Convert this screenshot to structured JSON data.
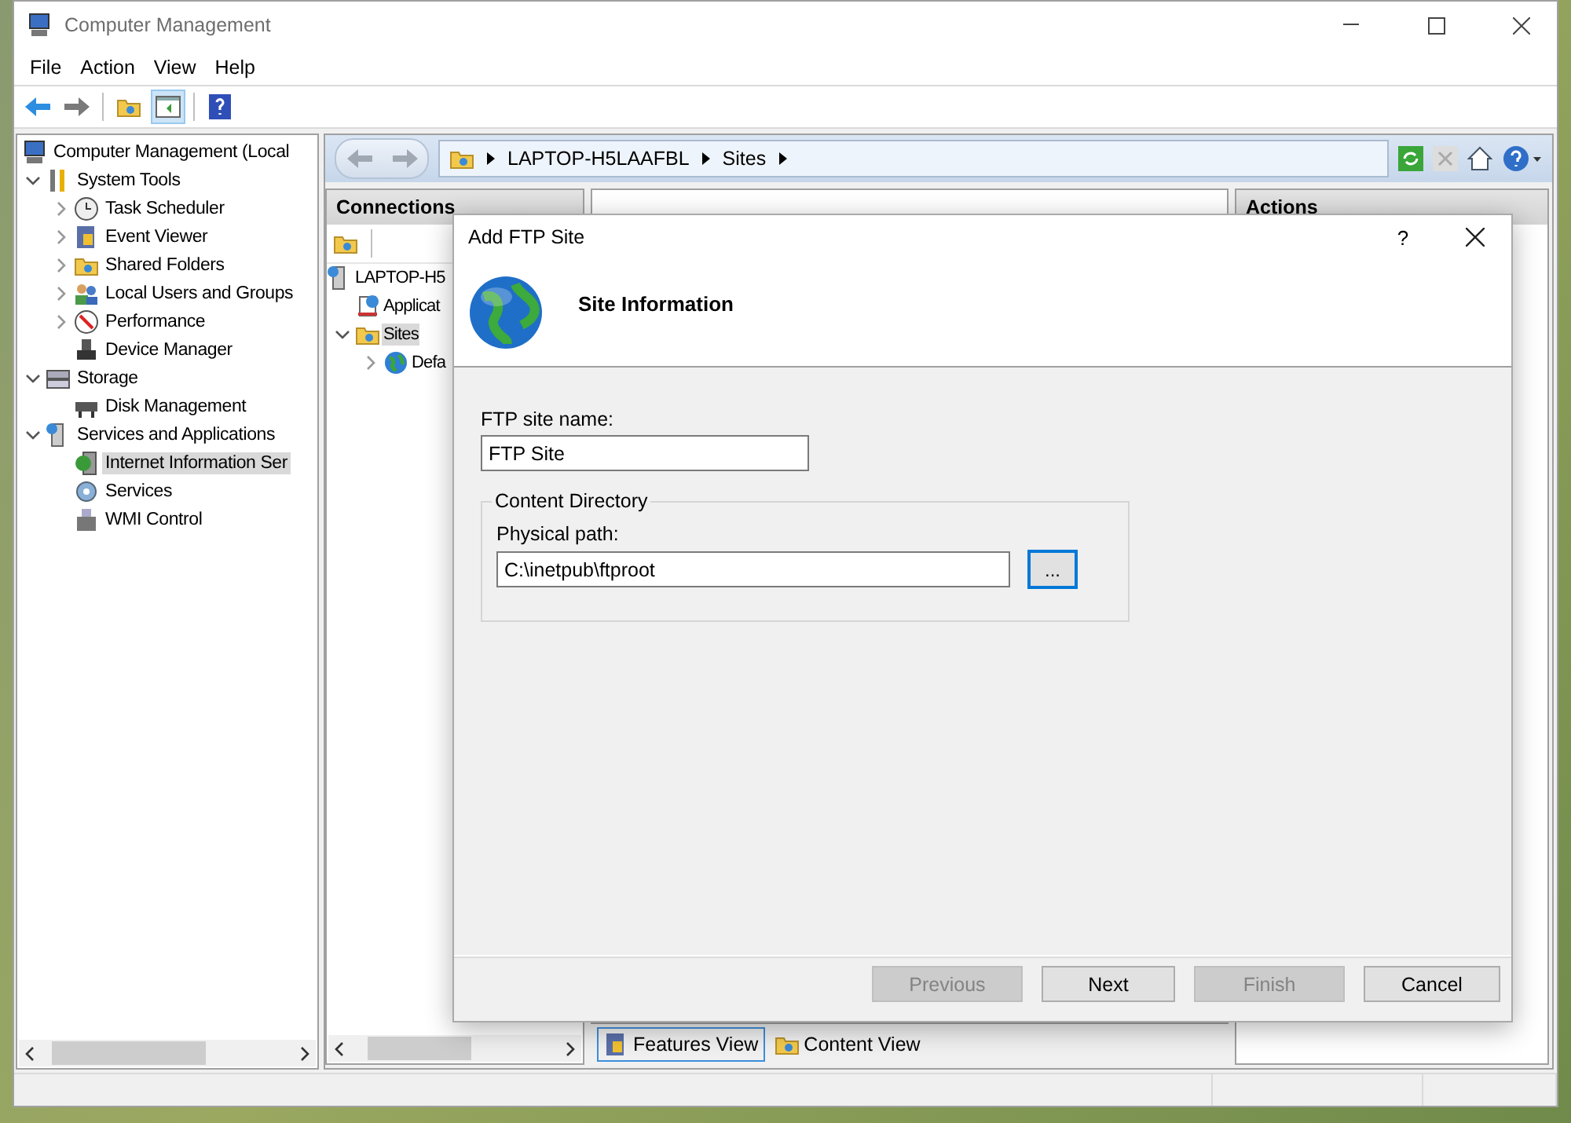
{
  "window": {
    "title": "Computer Management"
  },
  "menu": [
    "File",
    "Action",
    "View",
    "Help"
  ],
  "tree": [
    {
      "label": "Computer Management (Local",
      "selected": false,
      "children": [
        {
          "label": "System Tools",
          "selected": false,
          "expanded": true,
          "children": [
            {
              "label": "Task Scheduler",
              "selected": false,
              "expanded": false
            },
            {
              "label": "Event Viewer",
              "selected": false,
              "expanded": false
            },
            {
              "label": "Shared Folders",
              "selected": false,
              "expanded": false
            },
            {
              "label": "Local Users and Groups",
              "selected": false,
              "expanded": false
            },
            {
              "label": "Performance",
              "selected": false,
              "expanded": false
            },
            {
              "label": "Device Manager",
              "selected": false
            }
          ]
        },
        {
          "label": "Storage",
          "selected": false,
          "expanded": true,
          "children": [
            {
              "label": "Disk Management",
              "selected": false
            }
          ]
        },
        {
          "label": "Services and Applications",
          "selected": false,
          "expanded": true,
          "children": [
            {
              "label": "Internet Information Ser",
              "selected": true
            },
            {
              "label": "Services",
              "selected": false
            },
            {
              "label": "WMI Control",
              "selected": false
            }
          ]
        }
      ]
    }
  ],
  "iis": {
    "breadcrumb": [
      "LAPTOP-H5LAAFBL",
      "Sites"
    ],
    "connections": {
      "title": "Connections",
      "tree": [
        {
          "label": "LAPTOP-H5",
          "selected": false,
          "children": [
            {
              "label": "Applicat",
              "selected": false
            },
            {
              "label": "Sites",
              "selected": true,
              "expanded": true,
              "children": [
                {
                  "label": "Defa",
                  "selected": false,
                  "expanded": false
                }
              ]
            }
          ]
        }
      ]
    },
    "actions": {
      "title": "Actions"
    },
    "view_tabs": [
      {
        "label": "Features View",
        "selected": true
      },
      {
        "label": "Content View",
        "selected": false
      }
    ]
  },
  "dialog": {
    "title": "Add FTP Site",
    "help": "?",
    "heading": "Site Information",
    "site_name": {
      "label": "FTP site name:",
      "value": "FTP Site"
    },
    "content_directory": {
      "legend": "Content Directory",
      "path_label": "Physical path:",
      "path_value": "C:\\inetpub\\ftproot",
      "browse": "..."
    },
    "buttons": [
      {
        "label": "Previous",
        "disabled": true
      },
      {
        "label": "Next",
        "disabled": false
      },
      {
        "label": "Finish",
        "disabled": true
      },
      {
        "label": "Cancel",
        "disabled": false
      }
    ]
  }
}
